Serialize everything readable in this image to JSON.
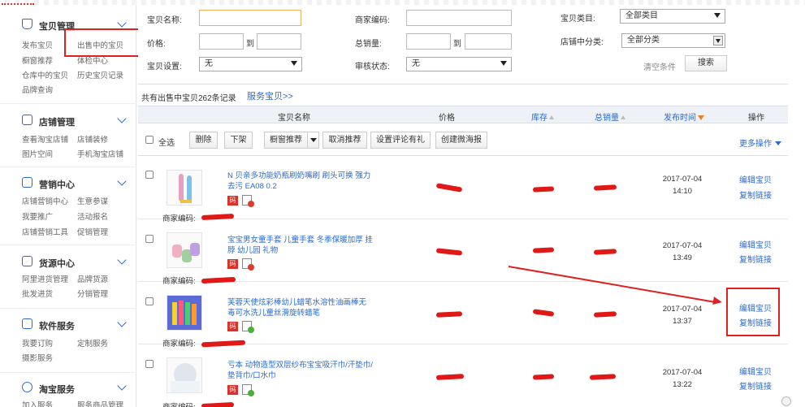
{
  "sidebar": {
    "sections": [
      {
        "title": "宝贝管理",
        "icon": "bag-icon",
        "links": [
          "发布宝贝",
          "出售中的宝贝",
          "橱窗推荐",
          "体检中心",
          "仓库中的宝贝",
          "历史宝贝记录",
          "品牌查询"
        ]
      },
      {
        "title": "店铺管理",
        "icon": "store-icon",
        "links": [
          "查看淘宝店铺",
          "店铺装修",
          "图片空间",
          "手机淘宝店铺"
        ]
      },
      {
        "title": "营销中心",
        "icon": "megaphone-icon",
        "links": [
          "店铺营销中心",
          "生意参谋",
          "我要推广",
          "活动报名",
          "店铺营销工具",
          "促销管理"
        ]
      },
      {
        "title": "货源中心",
        "icon": "box-icon",
        "links": [
          "阿里进货管理",
          "品牌货源",
          "批发进货",
          "分销管理"
        ]
      },
      {
        "title": "软件服务",
        "icon": "apps-icon",
        "links": [
          "我要订购",
          "定制服务",
          "摄影服务"
        ]
      },
      {
        "title": "淘宝服务",
        "icon": "service-icon",
        "links": [
          "加入服务",
          "服务商品管理"
        ]
      }
    ]
  },
  "filters": {
    "item_name_label": "宝贝名称:",
    "merchant_code_label": "商家编码:",
    "item_category_label": "宝贝类目:",
    "item_category_value": "全部类目",
    "price_label": "价格:",
    "to": "到",
    "total_sales_label": "总销量:",
    "shop_category_label": "店铺中分类:",
    "shop_category_value": "全部分类",
    "item_setting_label": "宝贝设置:",
    "item_setting_value": "无",
    "audit_status_label": "审核状态:",
    "audit_status_value": "无",
    "clear_label": "清空条件",
    "search_label": "搜索"
  },
  "summary": {
    "record_text": "共有出售中宝贝262条记录",
    "service_link": "服务宝贝>>"
  },
  "table": {
    "headers": {
      "name": "宝贝名称",
      "price": "价格",
      "stock": "库存",
      "sales": "总销量",
      "time": "发布时间",
      "ops": "操作"
    }
  },
  "actions": {
    "select_all": "全选",
    "delete": "删除",
    "delist": "下架",
    "window_recommend": "橱窗推荐",
    "cancel_recommend": "取消推荐",
    "set_review": "设置评论有礼",
    "create_poster": "创建微海报",
    "more_ops": "更多操作"
  },
  "products": [
    {
      "title": "N 贝亲多功能奶瓶刷奶嘴刷 刷头可换 强力去污 EA08 0.2",
      "date": "2017-07-04",
      "time": "14:10",
      "code_badge": "码",
      "merchant_label": "商家编码:",
      "edit": "编辑宝贝",
      "copy": "复制链接",
      "status_color": "#e03a2a"
    },
    {
      "title": "宝宝男女童手套 儿童手套 冬季保暖加厚 挂脖 幼儿园 礼物",
      "date": "2017-07-04",
      "time": "13:49",
      "code_badge": "码",
      "merchant_label": "商家编码:",
      "edit": "编辑宝贝",
      "copy": "复制链接",
      "status_color": "#e03a2a"
    },
    {
      "title": "芙蓉天使炫彩棒幼儿蜡笔水溶性油画棒无毒可水洗儿童丝滑旋转蜡笔",
      "date": "2017-07-04",
      "time": "13:37",
      "code_badge": "码",
      "merchant_label": "商家编码:",
      "edit": "编辑宝贝",
      "copy": "复制链接",
      "status_color": "#4caf3a"
    },
    {
      "title": "亏本 动物造型双层纱布宝宝吸汗巾/汗垫巾/垫背巾/口水巾",
      "date": "2017-07-04",
      "time": "13:22",
      "code_badge": "码",
      "merchant_label": "商家编码:",
      "edit": "编辑宝贝",
      "copy": "复制链接",
      "status_color": "#4caf3a"
    }
  ],
  "colors": {
    "accent": "#2a6ad1",
    "highlight_red": "#e02020",
    "header_bg": "#eef1f6"
  }
}
